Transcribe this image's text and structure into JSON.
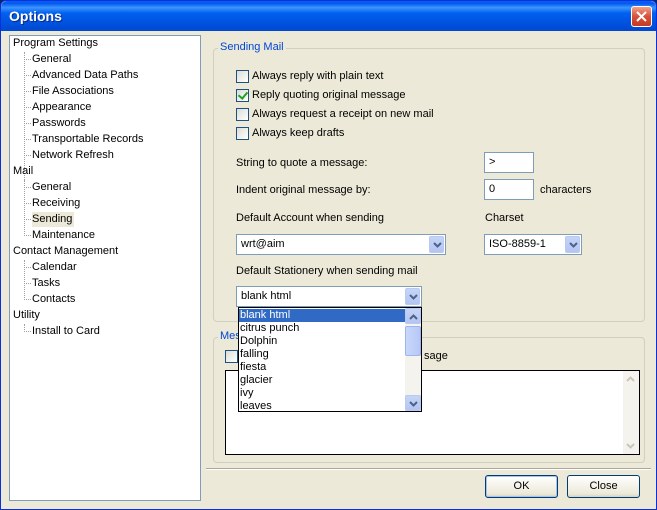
{
  "window": {
    "title": "Options"
  },
  "tree": {
    "groups": [
      {
        "label": "Program Settings",
        "children": [
          "General",
          "Advanced Data Paths",
          "File Associations",
          "Appearance",
          "Passwords",
          "Transportable Records",
          "Network Refresh"
        ]
      },
      {
        "label": "Mail",
        "children": [
          "General",
          "Receiving",
          "Sending",
          "Maintenance"
        ]
      },
      {
        "label": "Contact Management",
        "children": [
          "Calendar",
          "Tasks",
          "Contacts"
        ]
      },
      {
        "label": "Utility",
        "children": [
          "Install to Card"
        ]
      }
    ],
    "selected": "Sending"
  },
  "sending_mail": {
    "title": "Sending Mail",
    "checkboxes": [
      {
        "label": "Always reply with plain text",
        "checked": false
      },
      {
        "label": "Reply quoting original message",
        "checked": true
      },
      {
        "label": "Always request a receipt on new mail",
        "checked": false
      },
      {
        "label": "Always keep drafts",
        "checked": false
      }
    ],
    "quote_label": "String to quote a message:",
    "quote_value": ">",
    "indent_label": "Indent original message by:",
    "indent_value": "0",
    "indent_unit": "characters",
    "account_label": "Default Account when sending",
    "account_value": "wrt@aim",
    "charset_label": "Charset",
    "charset_value": "ISO-8859-1",
    "stationery_label": "Default Stationery when sending mail",
    "stationery_value": "blank html",
    "stationery_options": [
      "blank html",
      "citrus punch",
      "Dolphin",
      "falling",
      "fiesta",
      "glacier",
      "ivy",
      "leaves"
    ]
  },
  "message_group": {
    "title_visible": "Mes",
    "checkbox_label_visible": "sage"
  },
  "buttons": {
    "ok": "OK",
    "close": "Close"
  },
  "colors": {
    "title_bar": "#0058ee",
    "group_title": "#0046d5",
    "selection": "#316ac5"
  }
}
